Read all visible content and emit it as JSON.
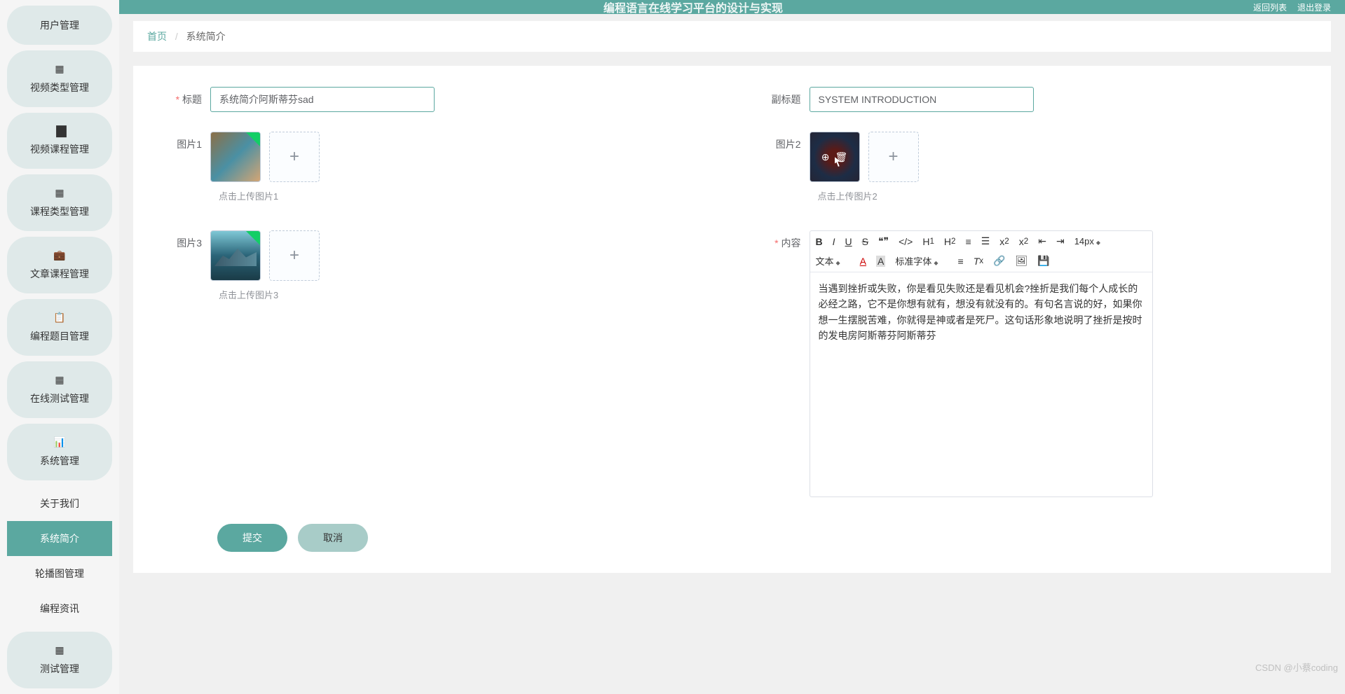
{
  "topbar": {
    "title": "编程语言在线学习平台的设计与实现",
    "right1": "返回列表",
    "right2": "退出登录"
  },
  "breadcrumb": {
    "home": "首页",
    "current": "系统简介"
  },
  "sidebar": {
    "items": [
      {
        "label": "用户管理"
      },
      {
        "label": "视频类型管理"
      },
      {
        "label": "视频课程管理"
      },
      {
        "label": "课程类型管理"
      },
      {
        "label": "文章课程管理"
      },
      {
        "label": "编程题目管理"
      },
      {
        "label": "在线测试管理"
      },
      {
        "label": "系统管理"
      }
    ],
    "subs": [
      {
        "label": "关于我们"
      },
      {
        "label": "系统简介"
      },
      {
        "label": "轮播图管理"
      },
      {
        "label": "编程资讯"
      }
    ],
    "last": {
      "label": "测试管理"
    }
  },
  "form": {
    "title_label": "标题",
    "title_value": "系统简介阿斯蒂芬sad",
    "subtitle_label": "副标题",
    "subtitle_value": "SYSTEM INTRODUCTION",
    "pic1_label": "图片1",
    "pic1_hint": "点击上传图片1",
    "pic2_label": "图片2",
    "pic2_hint": "点击上传图片2",
    "pic3_label": "图片3",
    "pic3_hint": "点击上传图片3",
    "content_label": "内容",
    "content_text": "当遇到挫折或失败，你是看见失败还是看见机会?挫折是我们每个人成长的必经之路，它不是你想有就有，想没有就没有的。有句名言说的好，如果你想一生摆脱苦难，你就得是神或者是死尸。这句话形象地说明了挫折是按时的发电房阿斯蒂芬阿斯蒂芬",
    "submit": "提交",
    "cancel": "取消"
  },
  "editor": {
    "font_size": "14px",
    "text_style": "文本",
    "font_family": "标准字体"
  },
  "watermark": "CSDN @小蔡coding"
}
